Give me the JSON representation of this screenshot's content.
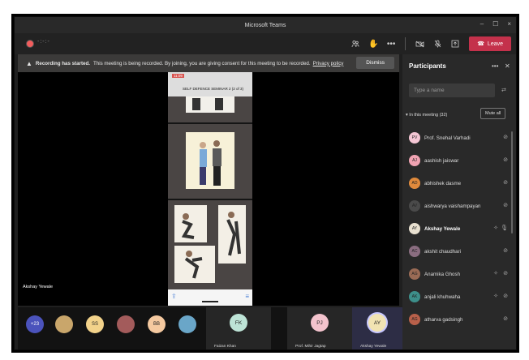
{
  "window": {
    "title": "Microsoft Teams",
    "controls": [
      "–",
      "☐",
      "×"
    ]
  },
  "toolbar": {
    "recording_time": "-:-:-",
    "icons": [
      "people-icon",
      "raise-hand-icon",
      "more-icon",
      "camera-off-icon",
      "mic-off-icon",
      "share-screen-icon"
    ],
    "leave_label": "Leave"
  },
  "banner": {
    "title": "Recording has started.",
    "message": "This meeting is being recorded. By joining, you are giving consent for this meeting to be recorded.",
    "link": "Privacy policy",
    "dismiss": "Dismiss"
  },
  "stage": {
    "phone_time": "11:09",
    "phone_title": "SELF DEFENCE SEMINAR 2 (2 of 3)",
    "presenter_name": "Akshay Yewale"
  },
  "participants": {
    "title": "Participants",
    "search_placeholder": "Type a name",
    "section_label": "In this meeting (32)",
    "mute_all": "Mute all",
    "list": [
      {
        "initials": "PV",
        "name": "Prof. Snehal Varhadi",
        "color": "#f4c6d4",
        "bold": false,
        "hand": false
      },
      {
        "initials": "AJ",
        "name": "aashish jaiswar",
        "color": "#f0a3b2",
        "bold": false,
        "hand": false
      },
      {
        "initials": "AD",
        "name": "abhishek dasme",
        "color": "#e08a3c",
        "bold": false,
        "hand": false
      },
      {
        "initials": "AV",
        "name": "aishwarya vaishampayan",
        "color": "#4a4a4a",
        "bold": false,
        "hand": false
      },
      {
        "initials": "AY",
        "name": "Akshay Yewale",
        "color": "#e8e0d0",
        "bold": true,
        "hand": true
      },
      {
        "initials": "AC",
        "name": "akshit chaudhari",
        "color": "#8a6d80",
        "bold": false,
        "hand": false
      },
      {
        "initials": "AG",
        "name": "Anamika Ghosh",
        "color": "#9a6b55",
        "bold": false,
        "hand": true
      },
      {
        "initials": "AK",
        "name": "anjali khuhwaha",
        "color": "#3d8f8a",
        "bold": false,
        "hand": true
      },
      {
        "initials": "AG",
        "name": "atharva gadsingh",
        "color": "#b8604a",
        "bold": false,
        "hand": false
      }
    ]
  },
  "bottom": {
    "overflow_count": "+23",
    "avatars": [
      {
        "text": "",
        "color": "#c9a66b"
      },
      {
        "text": "SS",
        "color": "#f2d28a"
      },
      {
        "text": "",
        "color": "#a35b5b"
      },
      {
        "text": "BB",
        "color": "#f5c9a0"
      },
      {
        "text": "",
        "color": "#6aa6c8"
      }
    ],
    "tiles": [
      {
        "initials": "FK",
        "name": "Faizan Khan",
        "color": "#bde3d6"
      },
      {
        "initials": "PJ",
        "name": "Prof. Mihir Jagtap",
        "color": "#f3c3cd"
      },
      {
        "initials": "AY",
        "name": "Akshay Yewale",
        "color": "#f1e3b2"
      }
    ]
  },
  "colors": {
    "leave": "#c4314b",
    "background": "#1f1f1f",
    "accent": "#6264a7"
  }
}
